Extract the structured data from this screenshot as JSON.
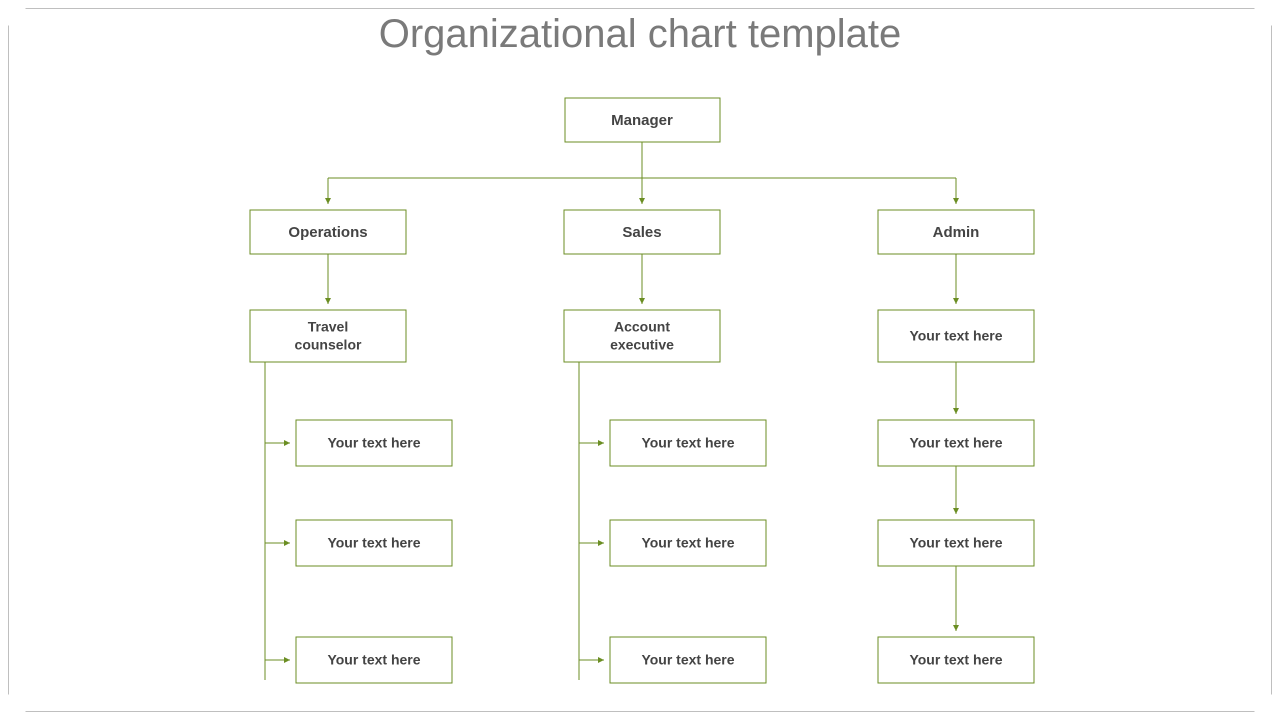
{
  "title": "Organizational chart template",
  "colors": {
    "line": "#6b8e23",
    "text": "#444444",
    "frame": "#bfbfbf"
  },
  "root": "Manager",
  "branches": [
    {
      "label": "Operations",
      "role": "Travel\ncounselor",
      "children": [
        "Your text here",
        "Your text here",
        "Your text here"
      ]
    },
    {
      "label": "Sales",
      "role": "Account\nexecutive",
      "children": [
        "Your text here",
        "Your text here",
        "Your text here"
      ]
    },
    {
      "label": "Admin",
      "role": "Your text here",
      "vertical": true,
      "children": [
        "Your text here",
        "Your text here",
        "Your text here"
      ]
    }
  ]
}
